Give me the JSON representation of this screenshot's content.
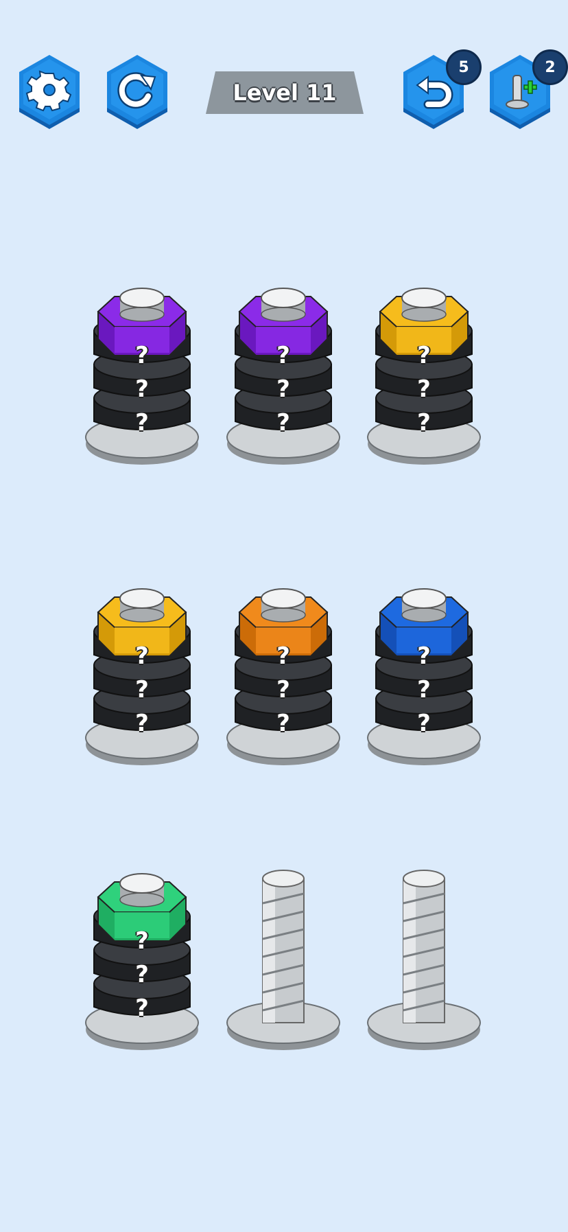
{
  "header": {
    "level_label": "Level 11",
    "undo_count": "5",
    "extra_bolt_count": "2"
  },
  "icons": {
    "settings": "gear-icon",
    "restart": "restart-icon",
    "undo": "undo-icon",
    "add_bolt": "add-bolt-icon"
  },
  "colors": {
    "background": "#dcebfb",
    "button_blue": "#1b86e0",
    "purple": "#8b2be8",
    "yellow": "#f6bc1c",
    "orange": "#f08a1c",
    "blue": "#1e6ae0",
    "green": "#2fd17c",
    "hidden_nut": "#3a3d42"
  },
  "board": {
    "bolts": [
      {
        "top_nut": "purple",
        "hidden_label": "?",
        "hidden_count": 3
      },
      {
        "top_nut": "purple",
        "hidden_label": "?",
        "hidden_count": 3
      },
      {
        "top_nut": "yellow",
        "hidden_label": "?",
        "hidden_count": 3
      },
      {
        "top_nut": "yellow",
        "hidden_label": "?",
        "hidden_count": 3
      },
      {
        "top_nut": "orange",
        "hidden_label": "?",
        "hidden_count": 3
      },
      {
        "top_nut": "blue",
        "hidden_label": "?",
        "hidden_count": 3
      },
      {
        "top_nut": "green",
        "hidden_label": "?",
        "hidden_count": 3
      },
      {
        "top_nut": null,
        "hidden_label": "",
        "hidden_count": 0
      },
      {
        "top_nut": null,
        "hidden_label": "",
        "hidden_count": 0
      }
    ]
  }
}
